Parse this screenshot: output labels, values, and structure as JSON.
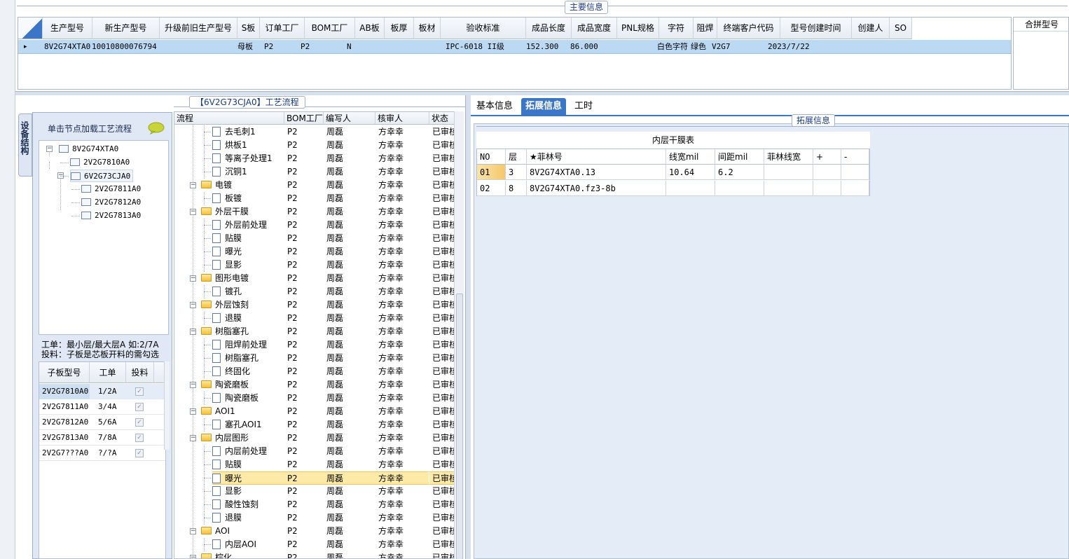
{
  "main_info": {
    "legend": "主要信息",
    "columns": [
      "生产型号",
      "新生产型号",
      "升级前旧生产型号",
      "S板",
      "订单工厂",
      "BOM工厂",
      "AB板",
      "板厚",
      "板材",
      "验收标准",
      "成品长度",
      "成品宽度",
      "PNL规格",
      "字符",
      "阻焊",
      "终端客户代码",
      "型号创建时间",
      "创建人",
      "SO"
    ],
    "row": {
      "marker": "▸",
      "model": "8V2G74XTA0",
      "new_model": "10010800076794",
      "old_model": "",
      "s_board": "母板",
      "order_factory": "P2",
      "bom_factory": "P2",
      "ab_board": "N",
      "thickness": "",
      "material": "",
      "standard": "IPC-6018 II级",
      "length": "152.300",
      "width": "86.000",
      "pnl": "",
      "char": "白色字符",
      "solder": "绿色",
      "customer": "V2G7",
      "created": "2023/7/22",
      "creator": "",
      "so": ""
    },
    "merge_label": "合拼型号"
  },
  "left": {
    "side_tab": "设备结构",
    "load_text": "单击节点加载工艺流程",
    "tree": [
      "8V2G74XTA0",
      "2V2G7810A0",
      "6V2G73CJA0",
      "2V2G7811A0",
      "2V2G7812A0",
      "2V2G7813A0"
    ],
    "note_line1": "工单：最小层/最大层A 如:2/7A",
    "note_line2": "投料：子板是芯板开料的需勾选",
    "sub_columns": [
      "子板型号",
      "工单",
      "投料"
    ],
    "sub_rows": [
      {
        "model": "2V2G7810A0",
        "order": "1/2A"
      },
      {
        "model": "2V2G7811A0",
        "order": "3/4A"
      },
      {
        "model": "2V2G7812A0",
        "order": "5/6A"
      },
      {
        "model": "2V2G7813A0",
        "order": "7/8A"
      },
      {
        "model": "2V2G7???A0",
        "order": "?/?A"
      }
    ],
    "check_mark": "✓"
  },
  "flow": {
    "legend": "【6V2G73CJA0】工艺流程",
    "columns": [
      "流程",
      "BOM工厂",
      "编写人",
      "核审人",
      "状态"
    ],
    "rows": [
      {
        "name": "去毛刺1",
        "folder": false,
        "bom": "P2",
        "writer": "周磊",
        "reviewer": "方幸幸",
        "status": "已审核"
      },
      {
        "name": "烘板1",
        "folder": false,
        "bom": "P2",
        "writer": "周磊",
        "reviewer": "方幸幸",
        "status": "已审核"
      },
      {
        "name": "等离子处理1",
        "folder": false,
        "bom": "P2",
        "writer": "周磊",
        "reviewer": "方幸幸",
        "status": "已审核"
      },
      {
        "name": "沉铜1",
        "folder": false,
        "bom": "P2",
        "writer": "周磊",
        "reviewer": "方幸幸",
        "status": "已审核"
      },
      {
        "name": "电镀",
        "folder": true,
        "bom": "P2",
        "writer": "周磊",
        "reviewer": "方幸幸",
        "status": "已审核"
      },
      {
        "name": "板镀",
        "folder": false,
        "bom": "P2",
        "writer": "周磊",
        "reviewer": "方幸幸",
        "status": "已审核"
      },
      {
        "name": "外层干膜",
        "folder": true,
        "bom": "P2",
        "writer": "周磊",
        "reviewer": "方幸幸",
        "status": "已审核"
      },
      {
        "name": "外层前处理",
        "folder": false,
        "bom": "P2",
        "writer": "周磊",
        "reviewer": "方幸幸",
        "status": "已审核"
      },
      {
        "name": "贴膜",
        "folder": false,
        "bom": "P2",
        "writer": "周磊",
        "reviewer": "方幸幸",
        "status": "已审核"
      },
      {
        "name": "曝光",
        "folder": false,
        "bom": "P2",
        "writer": "周磊",
        "reviewer": "方幸幸",
        "status": "已审核"
      },
      {
        "name": "显影",
        "folder": false,
        "bom": "P2",
        "writer": "周磊",
        "reviewer": "方幸幸",
        "status": "已审核"
      },
      {
        "name": "图形电镀",
        "folder": true,
        "bom": "P2",
        "writer": "周磊",
        "reviewer": "方幸幸",
        "status": "已审核"
      },
      {
        "name": "镀孔",
        "folder": false,
        "bom": "P2",
        "writer": "周磊",
        "reviewer": "方幸幸",
        "status": "已审核"
      },
      {
        "name": "外层蚀刻",
        "folder": true,
        "bom": "P2",
        "writer": "周磊",
        "reviewer": "方幸幸",
        "status": "已审核"
      },
      {
        "name": "退膜",
        "folder": false,
        "bom": "P2",
        "writer": "周磊",
        "reviewer": "方幸幸",
        "status": "已审核"
      },
      {
        "name": "树脂塞孔",
        "folder": true,
        "bom": "P2",
        "writer": "周磊",
        "reviewer": "方幸幸",
        "status": "已审核"
      },
      {
        "name": "阻焊前处理",
        "folder": false,
        "bom": "P2",
        "writer": "周磊",
        "reviewer": "方幸幸",
        "status": "已审核"
      },
      {
        "name": "树脂塞孔",
        "folder": false,
        "bom": "P2",
        "writer": "周磊",
        "reviewer": "方幸幸",
        "status": "已审核"
      },
      {
        "name": "终固化",
        "folder": false,
        "bom": "P2",
        "writer": "周磊",
        "reviewer": "方幸幸",
        "status": "已审核"
      },
      {
        "name": "陶瓷磨板",
        "folder": true,
        "bom": "P2",
        "writer": "周磊",
        "reviewer": "方幸幸",
        "status": "已审核"
      },
      {
        "name": "陶瓷磨板",
        "folder": false,
        "bom": "P2",
        "writer": "周磊",
        "reviewer": "方幸幸",
        "status": "已审核"
      },
      {
        "name": "AOI1",
        "folder": true,
        "bom": "P2",
        "writer": "周磊",
        "reviewer": "方幸幸",
        "status": "已审核"
      },
      {
        "name": "塞孔AOI1",
        "folder": false,
        "bom": "P2",
        "writer": "周磊",
        "reviewer": "方幸幸",
        "status": "已审核"
      },
      {
        "name": "内层图形",
        "folder": true,
        "bom": "P2",
        "writer": "周磊",
        "reviewer": "方幸幸",
        "status": "已审核"
      },
      {
        "name": "内层前处理",
        "folder": false,
        "bom": "P2",
        "writer": "周磊",
        "reviewer": "方幸幸",
        "status": "已审核"
      },
      {
        "name": "贴膜",
        "folder": false,
        "bom": "P2",
        "writer": "周磊",
        "reviewer": "方幸幸",
        "status": "已审核"
      },
      {
        "name": "曝光",
        "folder": false,
        "bom": "P2",
        "writer": "周磊",
        "reviewer": "方幸幸",
        "status": "已审核",
        "selected": true
      },
      {
        "name": "显影",
        "folder": false,
        "bom": "P2",
        "writer": "周磊",
        "reviewer": "方幸幸",
        "status": "已审核"
      },
      {
        "name": "酸性蚀刻",
        "folder": false,
        "bom": "P2",
        "writer": "周磊",
        "reviewer": "方幸幸",
        "status": "已审核"
      },
      {
        "name": "退膜",
        "folder": false,
        "bom": "P2",
        "writer": "周磊",
        "reviewer": "方幸幸",
        "status": "已审核"
      },
      {
        "name": "AOI",
        "folder": true,
        "bom": "P2",
        "writer": "周磊",
        "reviewer": "方幸幸",
        "status": "已审核"
      },
      {
        "name": "内层AOI",
        "folder": false,
        "bom": "P2",
        "writer": "周磊",
        "reviewer": "方幸幸",
        "status": "已审核"
      },
      {
        "name": "棕化",
        "folder": true,
        "bom": "P2",
        "writer": "周磊",
        "reviewer": "方幸幸",
        "status": "已审核"
      }
    ]
  },
  "right": {
    "tabs": [
      "基本信息",
      "拓展信息",
      "工时"
    ],
    "active_tab": 1,
    "legend": "拓展信息",
    "inner_title": "内层干膜表",
    "inner_columns": [
      "NO",
      "层",
      "★菲林号",
      "线宽mil",
      "间距mil",
      "菲林线宽",
      "+",
      "-"
    ],
    "inner_rows": [
      {
        "no": "01",
        "layer": "3",
        "film": "8V2G74XTA0.13",
        "line_width": "10.64",
        "spacing": "6.2",
        "film_width": ""
      },
      {
        "no": "02",
        "layer": "8",
        "film": "8V2G74XTA0.fz3-8b",
        "line_width": "",
        "spacing": "",
        "film_width": ""
      }
    ]
  },
  "colors": {
    "accent": "#3b76c7",
    "selected_row": "#bcd9f4",
    "highlight_row": "#fdeaa8",
    "folder": "#f4c23a"
  }
}
